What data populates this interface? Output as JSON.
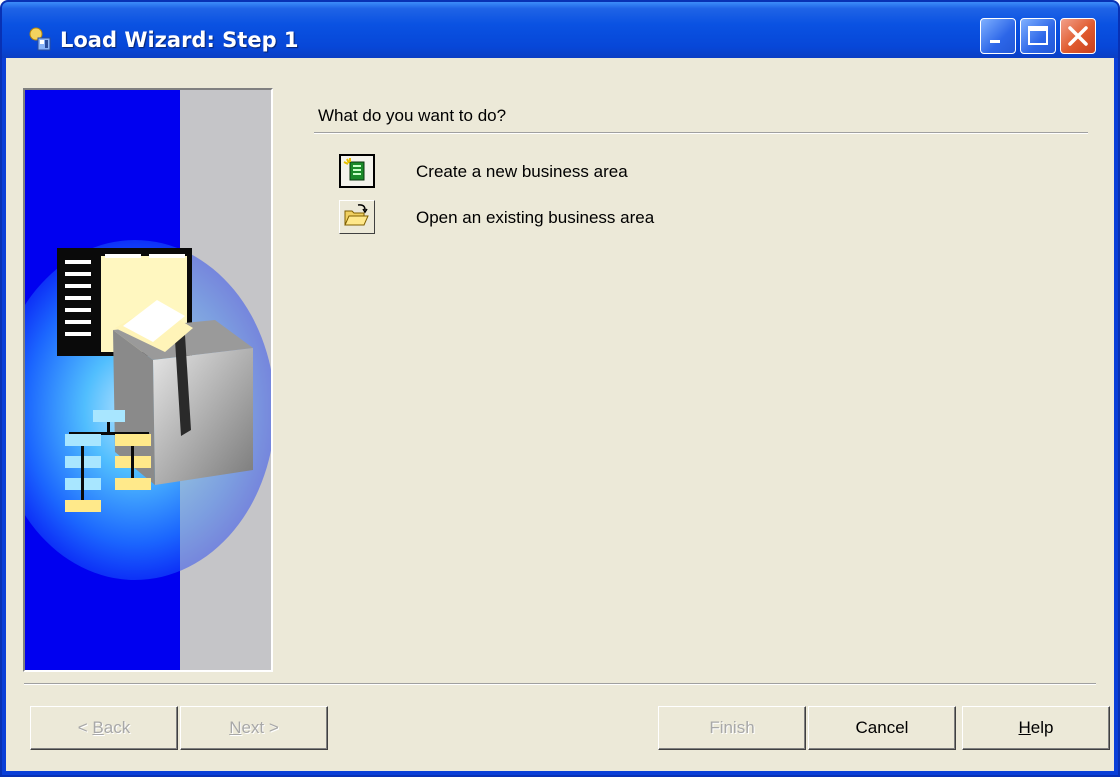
{
  "window": {
    "title": "Load Wizard: Step 1"
  },
  "main": {
    "question": "What do you want to do?",
    "options": [
      {
        "label": "Create a new business area",
        "icon": "new-business-area-icon",
        "selected": true
      },
      {
        "label": "Open an existing business area",
        "icon": "open-folder-icon",
        "selected": false
      }
    ]
  },
  "buttons": {
    "back_prefix": "< ",
    "back_mnemonic": "B",
    "back_rest": "ack",
    "next_mnemonic": "N",
    "next_rest": "ext >",
    "finish": "Finish",
    "cancel": "Cancel",
    "help_mnemonic": "H",
    "help_rest": "elp"
  },
  "colors": {
    "titlebar": "#0a52e2",
    "dialog_bg": "#ece9d8",
    "banner_blue": "#0000f0",
    "close_button": "#e05a2e"
  }
}
